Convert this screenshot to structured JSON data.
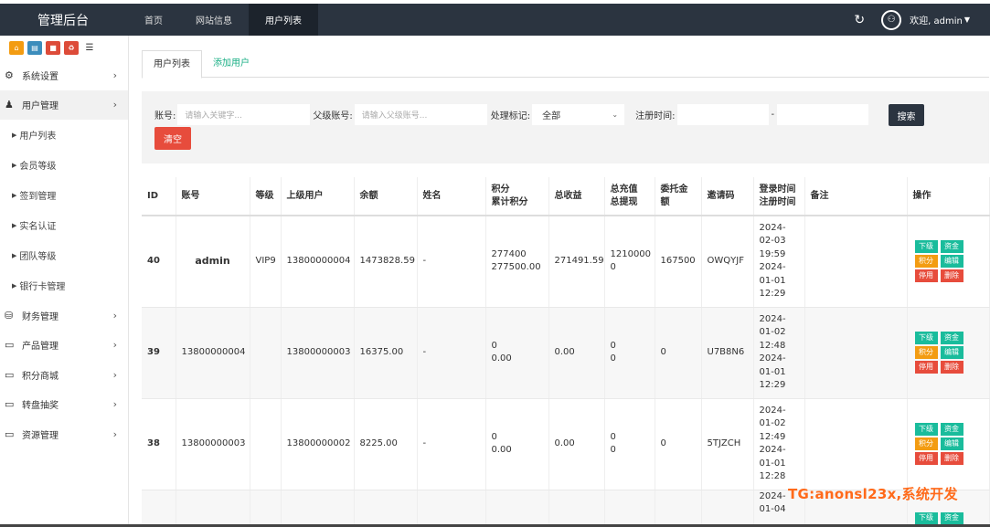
{
  "brand": "管理后台",
  "topnav": [
    {
      "label": "首页"
    },
    {
      "label": "网站信息"
    },
    {
      "label": "用户列表"
    }
  ],
  "user_greeting": "欢迎, admin",
  "sidebar": {
    "menu": [
      {
        "label": "系统设置"
      },
      {
        "label": "用户管理"
      }
    ],
    "sub": [
      {
        "label": "用户列表"
      },
      {
        "label": "会员等级"
      },
      {
        "label": "签到管理"
      },
      {
        "label": "实名认证"
      },
      {
        "label": "团队等级"
      },
      {
        "label": "银行卡管理"
      }
    ],
    "menu2": [
      {
        "label": "财务管理"
      },
      {
        "label": "产品管理"
      },
      {
        "label": "积分商城"
      },
      {
        "label": "转盘抽奖"
      },
      {
        "label": "资源管理"
      }
    ]
  },
  "tabs": [
    {
      "label": "用户列表"
    },
    {
      "label": "添加用户"
    }
  ],
  "filter": {
    "account_label": "账号:",
    "account_placeholder": "请输入关键字...",
    "parent_label": "父级账号:",
    "parent_placeholder": "请输入父级账号...",
    "mark_label": "处理标记:",
    "mark_value": "全部",
    "reg_label": "注册时间:",
    "dash": "-",
    "search": "搜索",
    "clear": "清空"
  },
  "table": {
    "headers": {
      "id": "ID",
      "account": "账号",
      "level": "等级",
      "parent": "上级用户",
      "balance": "余额",
      "name": "姓名",
      "points1": "积分",
      "points2": "累计积分",
      "income": "总收益",
      "recharge1": "总充值",
      "recharge2": "总提现",
      "entrust1": "委托金",
      "entrust2": "额",
      "invite": "邀请码",
      "time1": "登录时间",
      "time2": "注册时间",
      "remark": "备注",
      "ops": "操作"
    },
    "ops": {
      "sub": "下级",
      "fund": "资金",
      "points": "积分",
      "edit": "编辑",
      "disable": "停用",
      "delete": "删除"
    },
    "rows": [
      {
        "id": "40",
        "account": "admin",
        "level": "VIP9",
        "parent": "13800000004",
        "balance": "1473828.59",
        "name": "-",
        "points": "277400",
        "total_points": "277500.00",
        "income": "271491.59",
        "recharge_a": "1210000",
        "recharge_b": "0",
        "entrust": "167500",
        "invite": "OWQYJF",
        "time": [
          "2024-",
          "02-03",
          "19:59",
          "2024-",
          "01-01",
          "12:29"
        ]
      },
      {
        "id": "39",
        "account": "13800000004",
        "level": "",
        "parent": "13800000003",
        "balance": "16375.00",
        "name": "-",
        "points": "0",
        "total_points": "0.00",
        "income": "0.00",
        "recharge_a": "0",
        "recharge_b": "0",
        "entrust": "0",
        "invite": "U7B8N6",
        "time": [
          "2024-",
          "01-02",
          "12:48",
          "2024-",
          "01-01",
          "12:29"
        ]
      },
      {
        "id": "38",
        "account": "13800000003",
        "level": "",
        "parent": "13800000002",
        "balance": "8225.00",
        "name": "-",
        "points": "0",
        "total_points": "0.00",
        "income": "0.00",
        "recharge_a": "0",
        "recharge_b": "0",
        "entrust": "0",
        "invite": "5TJZCH",
        "time": [
          "2024-",
          "01-02",
          "12:49",
          "2024-",
          "01-01",
          "12:28"
        ]
      },
      {
        "time": [
          "2024-",
          "01-04"
        ]
      }
    ]
  },
  "watermark": "TG:anonsl23x,系统开发"
}
